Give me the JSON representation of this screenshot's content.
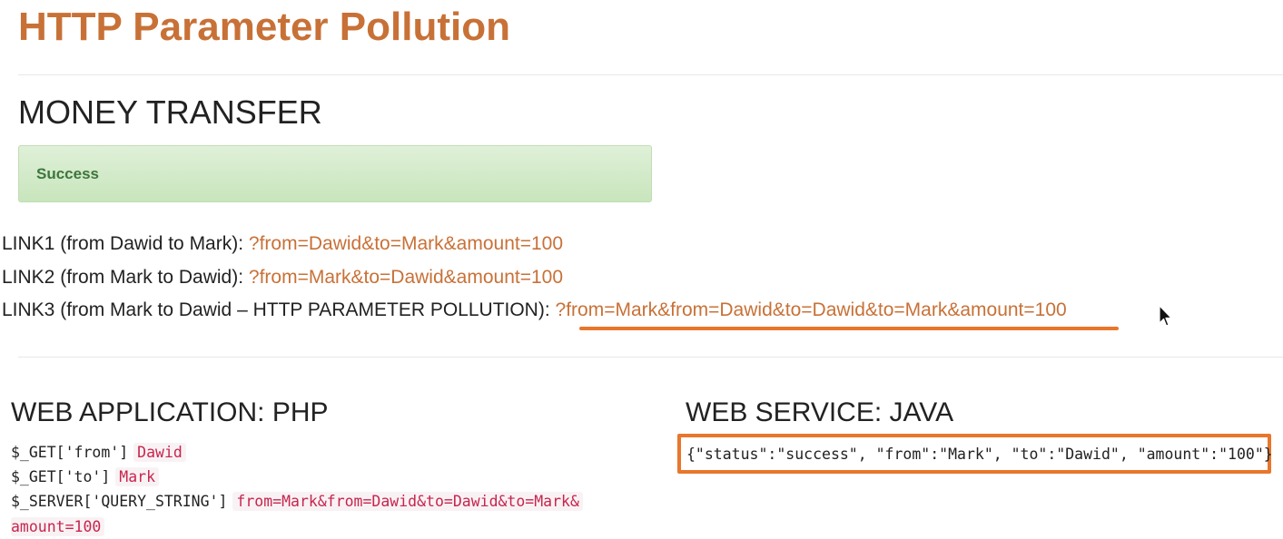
{
  "header": {
    "title": "HTTP Parameter Pollution"
  },
  "transfer": {
    "heading": "MONEY TRANSFER",
    "alert_text": "Success",
    "links": [
      {
        "label": "LINK1 (from Dawid to Mark): ",
        "href_text": "?from=Dawid&to=Mark&amount=100"
      },
      {
        "label": "LINK2 (from Mark to Dawid): ",
        "href_text": "?from=Mark&to=Dawid&amount=100"
      },
      {
        "label": "LINK3 (from Mark to Dawid – HTTP PARAMETER POLLUTION): ",
        "href_text": "?from=Mark&from=Dawid&to=Dawid&to=Mark&amount=100"
      }
    ]
  },
  "php": {
    "heading": "WEB APPLICATION: PHP",
    "rows": [
      {
        "key": "$_GET['from']",
        "value": "Dawid"
      },
      {
        "key": "$_GET['to']",
        "value": "Mark"
      },
      {
        "key": "$_SERVER['QUERY_STRING']",
        "value": "from=Mark&from=Dawid&to=Dawid&to=Mark&"
      },
      {
        "key": "",
        "value": "amount=100"
      }
    ]
  },
  "java": {
    "heading": "WEB SERVICE: JAVA",
    "response": "{\"status\":\"success\", \"from\":\"Mark\", \"to\":\"Dawid\", \"amount\":\"100\"}"
  },
  "colors": {
    "accent": "#c87137",
    "highlight": "#e8762b",
    "success_bg": "#dff0d8",
    "success_text": "#3c763d",
    "code_text": "#c7254e",
    "code_bg": "#f9f2f4"
  },
  "icons": {
    "cursor": "mouse-pointer-icon"
  }
}
